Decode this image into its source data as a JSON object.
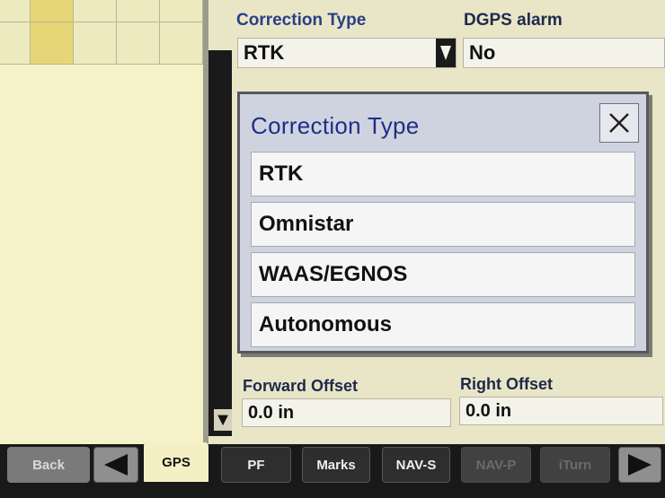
{
  "header": {
    "correction_type_label": "Correction Type",
    "correction_type_value": "RTK",
    "dgps_alarm_label": "DGPS alarm",
    "dgps_alarm_value": "No"
  },
  "dialog": {
    "title": "Correction Type",
    "options": [
      "RTK",
      "Omnistar",
      "WAAS/EGNOS",
      "Autonomous"
    ]
  },
  "offsets": {
    "forward_label": "Forward Offset",
    "forward_value": "0.0  in",
    "right_label": "Right Offset",
    "right_value": "0.0  in"
  },
  "bottom_nav": {
    "back": "Back",
    "gps": "GPS",
    "pf": "PF",
    "marks": "Marks",
    "nav_s": "NAV-S",
    "nav_p": "NAV-P",
    "iturn": "iTurn"
  },
  "icons": {
    "dropdown": "chevron-down-icon",
    "close": "close-icon",
    "prev": "arrow-left-icon",
    "next": "arrow-right-icon"
  },
  "colors": {
    "title_blue": "#1d2f86",
    "label_blue": "#2a3f87",
    "panel_yellow": "#f4f0c4"
  }
}
